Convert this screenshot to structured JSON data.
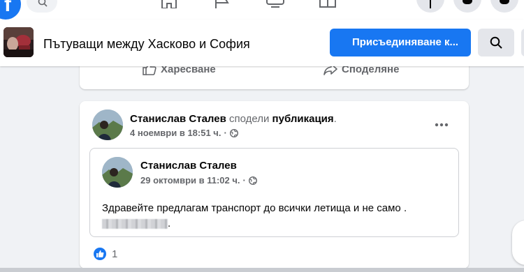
{
  "topnav": {
    "logo_letter": "f",
    "icons": [
      "home-icon",
      "flag-icon",
      "video-icon",
      "marketplace-icon",
      "groups-icon",
      "plus-icon",
      "messenger-icon",
      "bell-icon"
    ]
  },
  "group": {
    "title": "Пътуващи между Хасково и София",
    "join_label": "Присъединяване к...",
    "search_icon": "search-icon"
  },
  "prev_post": {
    "like_label": "Харесване",
    "share_label": "Споделяне"
  },
  "post": {
    "author": "Станислав Сталев",
    "shared_verb": "сподели",
    "shared_object": "публикация",
    "shared_end": ".",
    "timestamp": "4 ноември в 18:51 ч.",
    "separator": "·",
    "reaction_count": "1",
    "inner": {
      "author": "Станислав Сталев",
      "timestamp": "29 октомври в 11:02 ч.",
      "separator": "·",
      "text_line1": "Здравейте предлагам транспорт до всички летища и не само .",
      "text_line2_end": "."
    }
  },
  "colors": {
    "accent": "#1877f2",
    "background": "#f0f2f5",
    "secondary_text": "#65676b"
  }
}
